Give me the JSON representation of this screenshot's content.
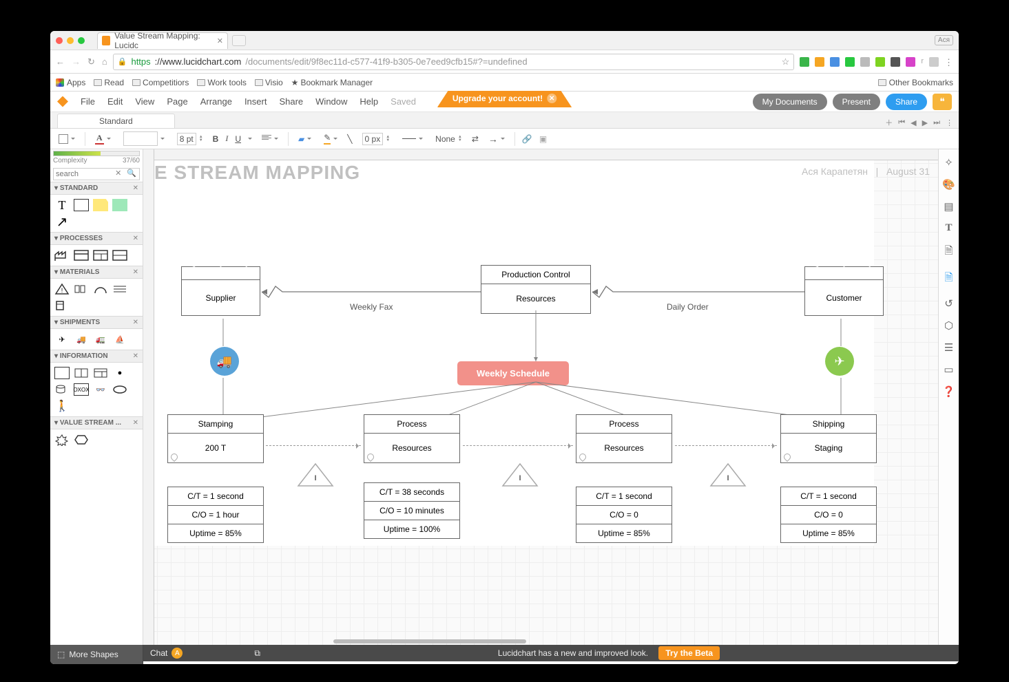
{
  "browser": {
    "tab_title": "Value Stream Mapping: Lucidc",
    "user_badge": "Aся",
    "url_protocol": "https",
    "url_domain": "://www.lucidchart.com",
    "url_path": "/documents/edit/9f8ec11d-c577-41f9-b305-0e7eed9cfb15#?=undefined",
    "bookmarks": {
      "apps": "Apps",
      "read": "Read",
      "competitors": "Competitiors",
      "worktools": "Work tools",
      "visio": "Visio",
      "bmmgr": "Bookmark Manager",
      "other": "Other Bookmarks"
    }
  },
  "app": {
    "menus": {
      "file": "File",
      "edit": "Edit",
      "view": "View",
      "page": "Page",
      "arrange": "Arrange",
      "insert": "Insert",
      "share": "Share",
      "window": "Window",
      "help": "Help",
      "saved": "Saved"
    },
    "upgrade": "Upgrade your account!",
    "buttons": {
      "mydocs": "My Documents",
      "present": "Present",
      "share": "Share"
    },
    "doc_tab": "Standard",
    "font_size": "8 pt",
    "border_px": "0 px",
    "line_style": "None"
  },
  "left": {
    "complexity_label": "Complexity",
    "complexity_val": "37/60",
    "search_placeholder": "search",
    "sections": {
      "standard": "STANDARD",
      "processes": "PROCESSES",
      "materials": "MATERIALS",
      "shipments": "SHIPMENTS",
      "information": "INFORMATION",
      "vsm": "VALUE STREAM ..."
    },
    "more_shapes": "More Shapes"
  },
  "canvas": {
    "title": "E STREAM MAPPING",
    "author": "Ася Карапетян",
    "divider": "|",
    "date": "August 31",
    "supplier": "Supplier",
    "customer": "Customer",
    "prodctrl_h": "Production Control",
    "prodctrl_b": "Resources",
    "weekly_fax": "Weekly Fax",
    "daily_order": "Daily Order",
    "schedule": "Weekly Schedule",
    "p1_h": "Stamping",
    "p1_b": "200 T",
    "p2_h": "Process",
    "p2_b": "Resources",
    "p3_h": "Process",
    "p3_b": "Resources",
    "p4_h": "Shipping",
    "p4_b": "Staging",
    "d1_r1": "C/T = 1 second",
    "d1_r2": "C/O = 1 hour",
    "d1_r3": "Uptime = 85%",
    "d2_r1": "C/T = 38 seconds",
    "d2_r2": "C/O = 10 minutes",
    "d2_r3": "Uptime = 100%",
    "d3_r1": "C/T = 1 second",
    "d3_r2": "C/O = 0",
    "d3_r3": "Uptime = 85%",
    "d4_r1": "C/T = 1 second",
    "d4_r2": "C/O = 0",
    "d4_r3": "Uptime = 85%",
    "tri": "I"
  },
  "bottom": {
    "chat": "Chat",
    "chat_initial": "A",
    "msg": "Lucidchart has a new and improved look.",
    "try": "Try the Beta"
  }
}
